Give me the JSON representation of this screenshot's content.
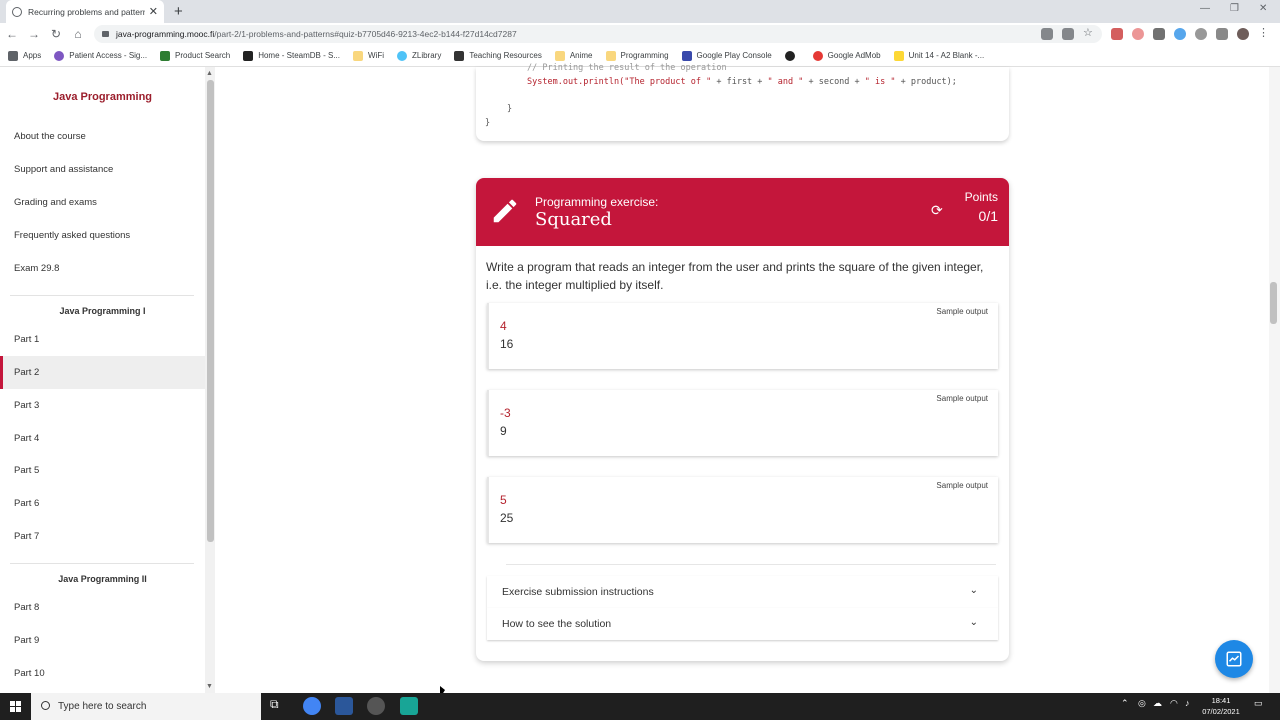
{
  "browser": {
    "tab_title": "Recurring problems and patterns",
    "url_host": "java-programming.mooc.fi",
    "url_path": "/part-2/1-problems-and-patterns#quiz-b7705d46-9213-4ec2-b144-f27d14cd7287",
    "bookmarks": [
      "Apps",
      "Patient Access - Sig...",
      "Product Search",
      "Home - SteamDB - S...",
      "WiFi",
      "ZLibrary",
      "Teaching Resources",
      "Anime",
      "Programming",
      "Google Play Console",
      "",
      "Google AdMob",
      "Unit 14 - A2 Blank -..."
    ]
  },
  "sidebar": {
    "title": "Java Programming",
    "items": [
      "About the course",
      "Support and assistance",
      "Grading and exams",
      "Frequently asked questions",
      "Exam 29.8"
    ],
    "section1": "Java Programming I",
    "parts1": [
      "Part 1",
      "Part 2",
      "Part 3",
      "Part 4",
      "Part 5",
      "Part 6",
      "Part 7"
    ],
    "section2": "Java Programming II",
    "parts2": [
      "Part 8",
      "Part 9",
      "Part 10"
    ]
  },
  "code": {
    "line1": "// Printing the result of the operation",
    "line2_a": "System.out.println(",
    "line2_b": "\"The product of \"",
    "line2_c": " + first + ",
    "line2_d": "\" and \"",
    "line2_e": " + second + ",
    "line2_f": "\" is \"",
    "line2_g": " + product);",
    "line3": "}",
    "line4": "}"
  },
  "exercise": {
    "label": "Programming exercise:",
    "name": "Squared",
    "points_label": "Points",
    "points_value": "0/1",
    "description": "Write a program that reads an integer from the user and prints the square of the given integer, i.e. the integer multiplied by itself.",
    "samples": [
      {
        "label": "Sample output",
        "input": "4",
        "output": "16"
      },
      {
        "label": "Sample output",
        "input": "-3",
        "output": "9"
      },
      {
        "label": "Sample output",
        "input": "5",
        "output": "25"
      }
    ],
    "accordions": [
      "Exercise submission instructions",
      "How to see the solution"
    ]
  },
  "taskbar": {
    "search_placeholder": "Type here to search",
    "time": "18:41",
    "date": "07/02/2021"
  }
}
